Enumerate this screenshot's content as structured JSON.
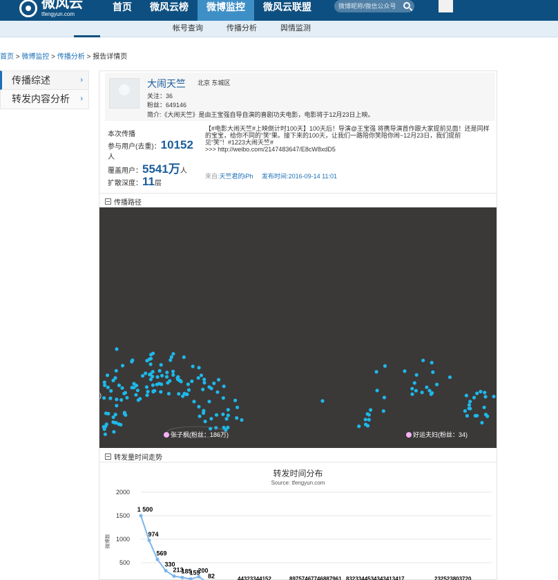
{
  "header": {
    "logo_cn": "微风云",
    "logo_en": "tfengyun.com",
    "nav": [
      "首页",
      "微风云榜",
      "微博监控",
      "微风云联盟"
    ],
    "search_placeholder": "微博昵称/微信公众号"
  },
  "subnav": [
    "帐号查询",
    "传播分析",
    "舆情监测"
  ],
  "breadcrumb": [
    "首页",
    "微博监控",
    "传播分析",
    "报告详情页"
  ],
  "sidebar": [
    "传播综述",
    "转发内容分析"
  ],
  "profile": {
    "name": "大闹天竺",
    "location": "北京 东城区",
    "follow": "关注：36",
    "fans": "粉丝：649146",
    "intro": "简介:《大闹天竺》是由王宝强自导自演的喜剧功夫电影，电影将于12月23日上映。"
  },
  "stats": {
    "heading": "本次传播",
    "participants_label": "参与用户(去重)：",
    "participants_value": "10152",
    "participants_unit": "人",
    "coverage_label": "覆盖用户：",
    "coverage_value": "5541万",
    "coverage_unit": "人",
    "depth_label": "扩散深度：",
    "depth_value": "11",
    "depth_unit": "层"
  },
  "weibo": {
    "line1": "【#电影大闹天竺#上映倒计时100天】100天后！导演@王宝强 将携导演首作跟大家提前见面！还是同样",
    "line2": "的宝宝，给你不同的“笑”果。接下来的100天，让我们一路陪你笑陪你闹~12月23日，我们提前",
    "line3": "见“笑”！#1223大闹天竺#",
    "line4": ">>> http://weibo.com/2147483647/E8cW8xdD5",
    "source_label": "来自:",
    "source_value": "天竺君的iPh",
    "time_label": "发布时间:",
    "time_value": "2016-09-14 11:01"
  },
  "sections": {
    "path": "传播路径",
    "trend": "转发量时间走势"
  },
  "graph": {
    "node_left": "张子枫(粉丝：186万)",
    "node_right": "好运夫妇(粉丝：34)",
    "edge_marker": ")",
    "dot_color": "#1eb8e8",
    "bg_color": "#3b3838"
  },
  "chart_data": {
    "type": "line",
    "title": "转发时间分布",
    "subtitle": "Source: tfengyun.com",
    "ylabel": "微博数",
    "ylim": [
      0,
      2000
    ],
    "yticks": [
      500,
      1000,
      1500,
      2000
    ],
    "values": [
      1500,
      974,
      569,
      330,
      213,
      185,
      155,
      200,
      82,
      44,
      33,
      22,
      33,
      41,
      52
    ],
    "value_labels": [
      "1 500",
      "974",
      "569",
      "330",
      "213",
      "185",
      "155",
      "200",
      "82"
    ],
    "tail_text": "44323344152",
    "tail_text2": "89757467746887961",
    "tail_text3": "8323344534343413417",
    "tail_text4": "232523803720"
  }
}
